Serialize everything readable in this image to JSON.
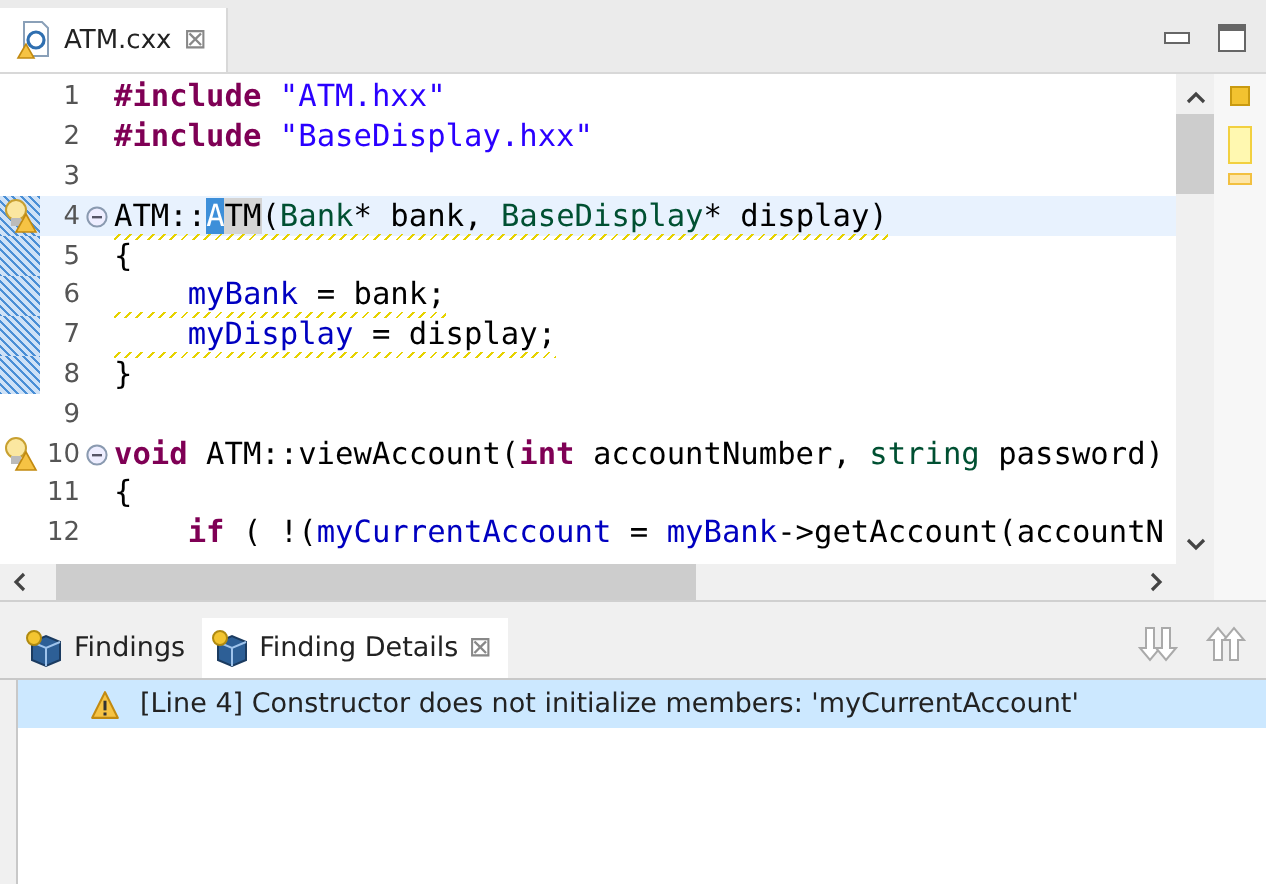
{
  "editor": {
    "tab": {
      "title": "ATM.cxx",
      "close": "⊠",
      "selected": true
    },
    "lines": [
      {
        "number": "1",
        "tokens": [
          {
            "kind": "preproc",
            "text": "#include"
          },
          {
            "kind": "string",
            "text": " \"ATM.hxx\""
          }
        ]
      },
      {
        "number": "2",
        "tokens": [
          {
            "kind": "preproc",
            "text": "#include"
          },
          {
            "kind": "string",
            "text": " \"BaseDisplay.hxx\""
          }
        ]
      },
      {
        "number": "3"
      },
      {
        "number": "4",
        "highlighted": true,
        "changed": true,
        "marker": true,
        "fold": true,
        "squiggle": true,
        "tokens": [
          {
            "kind": "plain",
            "text": "ATM::"
          },
          {
            "kind": "selected",
            "text": "A"
          },
          {
            "kind": "occurrence",
            "text": "TM"
          },
          {
            "kind": "plain",
            "text": "("
          },
          {
            "kind": "type",
            "text": "Bank"
          },
          {
            "kind": "plain",
            "text": "* bank, "
          },
          {
            "kind": "type",
            "text": "BaseDisplay"
          },
          {
            "kind": "plain",
            "text": "* display)"
          }
        ]
      },
      {
        "number": "5",
        "changed": true,
        "tokens": [
          {
            "kind": "plain",
            "text": "{"
          }
        ]
      },
      {
        "number": "6",
        "changed": true,
        "squiggle": true,
        "tokens": [
          {
            "kind": "field",
            "text": "    myBank"
          },
          {
            "kind": "plain",
            "text": " = bank;"
          }
        ]
      },
      {
        "number": "7",
        "changed": true,
        "squiggle": true,
        "tokens": [
          {
            "kind": "field",
            "text": "    myDisplay"
          },
          {
            "kind": "plain",
            "text": " = display;"
          }
        ]
      },
      {
        "number": "8",
        "changed": true,
        "tokens": [
          {
            "kind": "plain",
            "text": "}"
          }
        ]
      },
      {
        "number": "9"
      },
      {
        "number": "10",
        "marker": true,
        "fold": true,
        "tokens": [
          {
            "kind": "keyword",
            "text": "void"
          },
          {
            "kind": "plain",
            "text": " ATM::viewAccount("
          },
          {
            "kind": "keyword",
            "text": "int"
          },
          {
            "kind": "plain",
            "text": " accountNumber, "
          },
          {
            "kind": "type",
            "text": "string"
          },
          {
            "kind": "plain",
            "text": " password)"
          }
        ]
      },
      {
        "number": "11",
        "tokens": [
          {
            "kind": "plain",
            "text": "{"
          }
        ]
      },
      {
        "number": "12",
        "tokens": [
          {
            "kind": "keyword",
            "text": "    if"
          },
          {
            "kind": "plain",
            "text": " ( !("
          },
          {
            "kind": "field",
            "text": "myCurrentAccount"
          },
          {
            "kind": "plain",
            "text": " = "
          },
          {
            "kind": "field",
            "text": "myBank"
          },
          {
            "kind": "plain",
            "text": "->getAccount(accountN"
          }
        ]
      }
    ]
  },
  "panel": {
    "tabs": [
      {
        "label": "Findings",
        "selected": false
      },
      {
        "label": "Finding Details",
        "selected": true,
        "close": "⊠"
      }
    ],
    "findings": [
      {
        "text": "[Line 4] Constructor does not initialize members: 'myCurrentAccount'",
        "selected": true
      }
    ]
  }
}
